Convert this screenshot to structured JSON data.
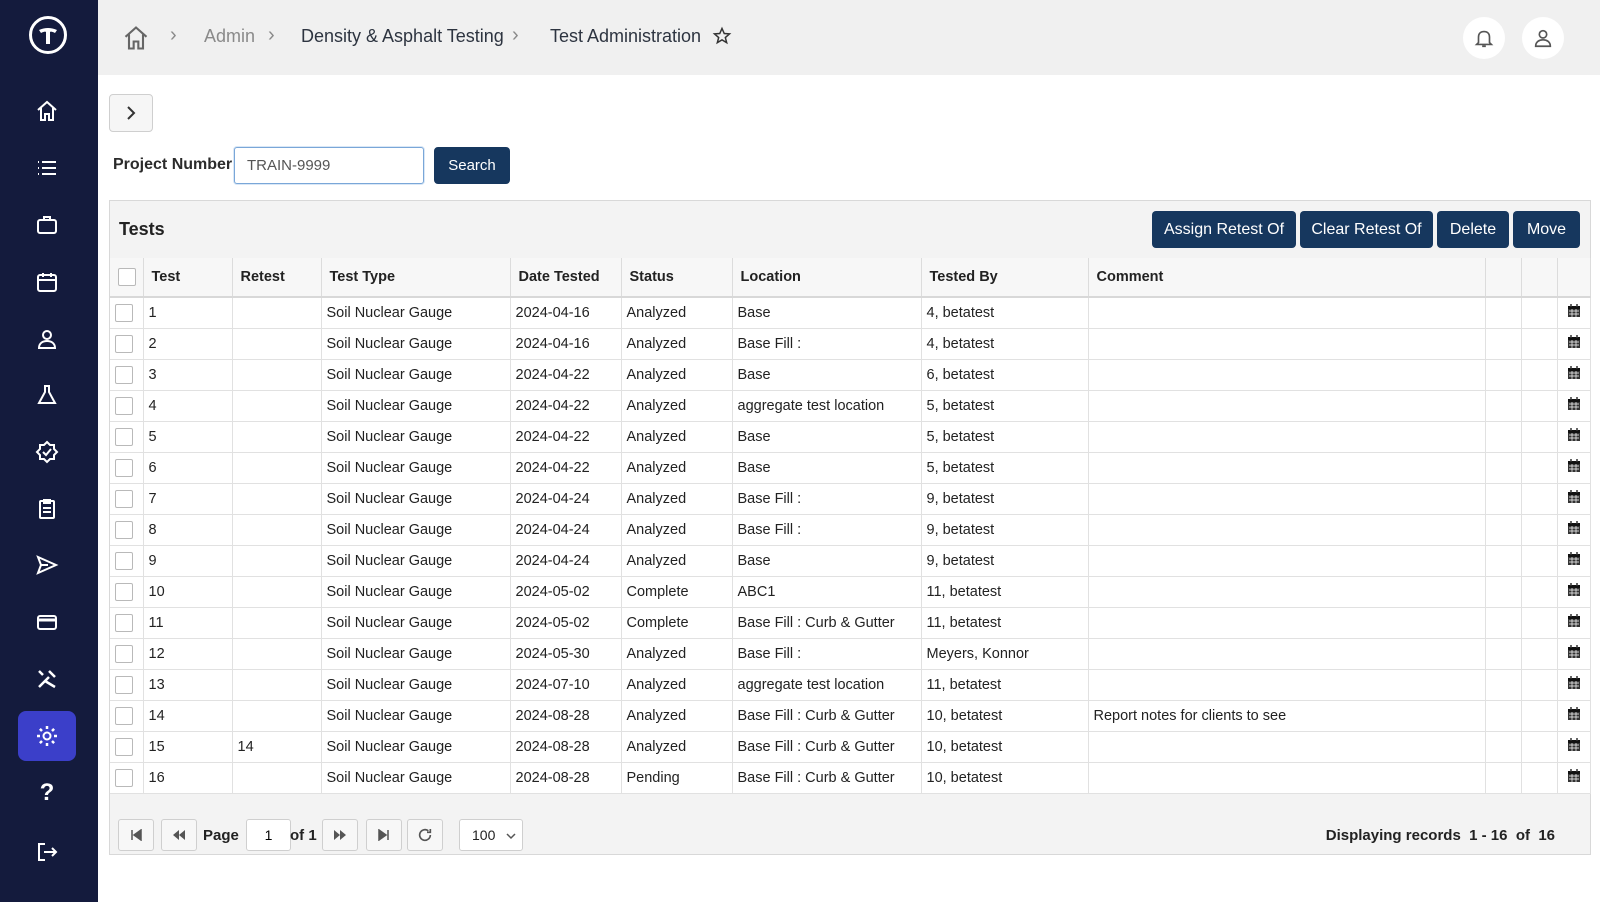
{
  "breadcrumb": {
    "items": [
      "Admin",
      "Density & Asphalt Testing",
      "Test Administration"
    ]
  },
  "search": {
    "label": "Project Number",
    "value": "TRAIN-9999",
    "button": "Search"
  },
  "panel": {
    "title": "Tests",
    "actions": [
      "Assign Retest Of",
      "Clear Retest Of",
      "Delete",
      "Move"
    ]
  },
  "table": {
    "columns": [
      "Test",
      "Retest",
      "Test Type",
      "Date Tested",
      "Status",
      "Location",
      "Tested By",
      "Comment"
    ],
    "rows": [
      {
        "test": "1",
        "retest": "",
        "type": "Soil Nuclear Gauge",
        "date": "2024-04-16",
        "status": "Analyzed",
        "location": "Base",
        "tested_by": "4, betatest",
        "comment": ""
      },
      {
        "test": "2",
        "retest": "",
        "type": "Soil Nuclear Gauge",
        "date": "2024-04-16",
        "status": "Analyzed",
        "location": "Base Fill :",
        "tested_by": "4, betatest",
        "comment": ""
      },
      {
        "test": "3",
        "retest": "",
        "type": "Soil Nuclear Gauge",
        "date": "2024-04-22",
        "status": "Analyzed",
        "location": "Base",
        "tested_by": "6, betatest",
        "comment": ""
      },
      {
        "test": "4",
        "retest": "",
        "type": "Soil Nuclear Gauge",
        "date": "2024-04-22",
        "status": "Analyzed",
        "location": "aggregate test location",
        "tested_by": "5, betatest",
        "comment": ""
      },
      {
        "test": "5",
        "retest": "",
        "type": "Soil Nuclear Gauge",
        "date": "2024-04-22",
        "status": "Analyzed",
        "location": "Base",
        "tested_by": "5, betatest",
        "comment": ""
      },
      {
        "test": "6",
        "retest": "",
        "type": "Soil Nuclear Gauge",
        "date": "2024-04-22",
        "status": "Analyzed",
        "location": "Base",
        "tested_by": "5, betatest",
        "comment": ""
      },
      {
        "test": "7",
        "retest": "",
        "type": "Soil Nuclear Gauge",
        "date": "2024-04-24",
        "status": "Analyzed",
        "location": "Base Fill :",
        "tested_by": "9, betatest",
        "comment": ""
      },
      {
        "test": "8",
        "retest": "",
        "type": "Soil Nuclear Gauge",
        "date": "2024-04-24",
        "status": "Analyzed",
        "location": "Base Fill :",
        "tested_by": "9, betatest",
        "comment": ""
      },
      {
        "test": "9",
        "retest": "",
        "type": "Soil Nuclear Gauge",
        "date": "2024-04-24",
        "status": "Analyzed",
        "location": "Base",
        "tested_by": "9, betatest",
        "comment": ""
      },
      {
        "test": "10",
        "retest": "",
        "type": "Soil Nuclear Gauge",
        "date": "2024-05-02",
        "status": "Complete",
        "location": "ABC1",
        "tested_by": "11, betatest",
        "comment": ""
      },
      {
        "test": "11",
        "retest": "",
        "type": "Soil Nuclear Gauge",
        "date": "2024-05-02",
        "status": "Complete",
        "location": "Base Fill : Curb & Gutter",
        "tested_by": "11, betatest",
        "comment": ""
      },
      {
        "test": "12",
        "retest": "",
        "type": "Soil Nuclear Gauge",
        "date": "2024-05-30",
        "status": "Analyzed",
        "location": "Base Fill :",
        "tested_by": "Meyers, Konnor",
        "comment": ""
      },
      {
        "test": "13",
        "retest": "",
        "type": "Soil Nuclear Gauge",
        "date": "2024-07-10",
        "status": "Analyzed",
        "location": "aggregate test location",
        "tested_by": "11, betatest",
        "comment": ""
      },
      {
        "test": "14",
        "retest": "",
        "type": "Soil Nuclear Gauge",
        "date": "2024-08-28",
        "status": "Analyzed",
        "location": "Base Fill : Curb & Gutter",
        "tested_by": "10, betatest",
        "comment": "Report notes for clients to see"
      },
      {
        "test": "15",
        "retest": "14",
        "type": "Soil Nuclear Gauge",
        "date": "2024-08-28",
        "status": "Analyzed",
        "location": "Base Fill : Curb & Gutter",
        "tested_by": "10, betatest",
        "comment": ""
      },
      {
        "test": "16",
        "retest": "",
        "type": "Soil Nuclear Gauge",
        "date": "2024-08-28",
        "status": "Pending",
        "location": "Base Fill : Curb & Gutter",
        "tested_by": "10, betatest",
        "comment": ""
      }
    ]
  },
  "pager": {
    "page_label": "Page",
    "page": "1",
    "of_label": "of 1",
    "page_size": "100",
    "status": "Displaying records  1 - 16  of  16"
  },
  "sidebar": {
    "items": [
      "home-icon",
      "list-icon",
      "briefcase-icon",
      "calendar-icon",
      "user-badge-icon",
      "flask-icon",
      "verified-check-icon",
      "clipboard-icon",
      "send-icon",
      "credit-card-icon",
      "tools-icon",
      "settings-gear-icon",
      "help-icon",
      "logout-icon"
    ],
    "active": "settings-gear-icon"
  },
  "colors": {
    "sidebar": "#141b3d",
    "active_nav": "#3b3fc9",
    "button": "#16375e"
  }
}
